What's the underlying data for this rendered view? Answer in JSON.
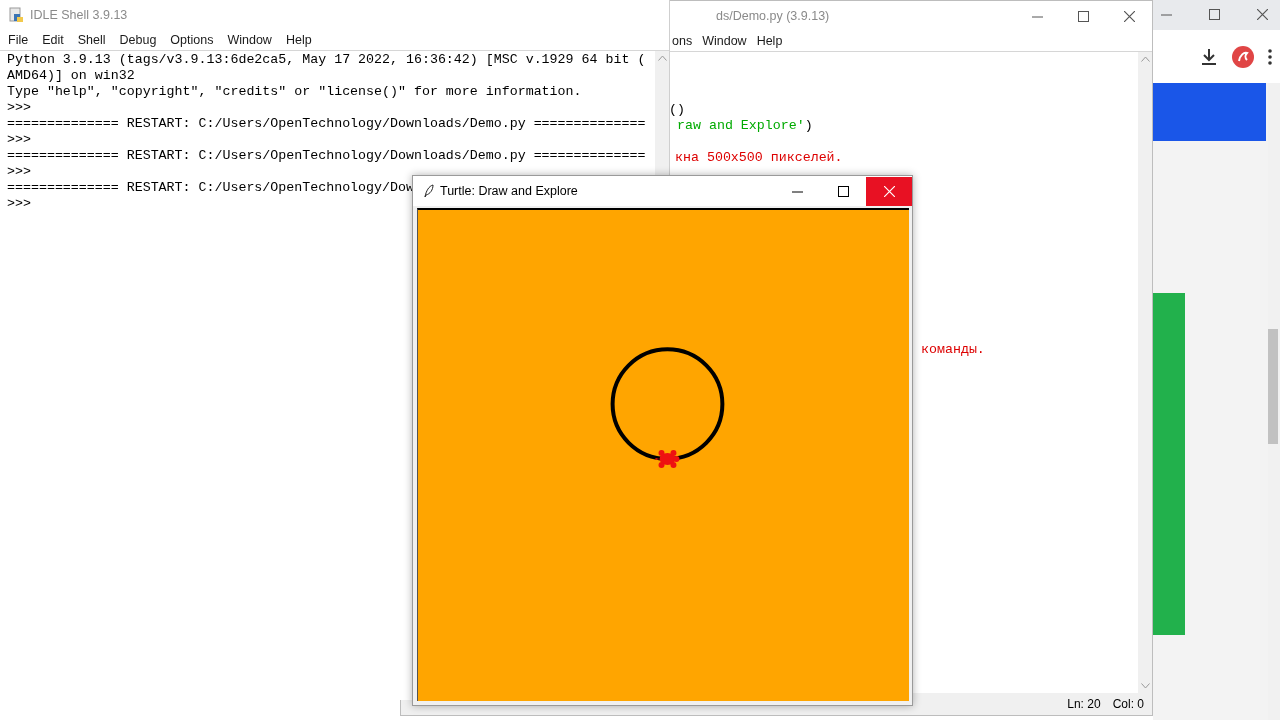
{
  "shell": {
    "title": "IDLE Shell 3.9.13",
    "menu": [
      "File",
      "Edit",
      "Shell",
      "Debug",
      "Options",
      "Window",
      "Help"
    ],
    "lines": [
      "Python 3.9.13 (tags/v3.9.13:6de2ca5, May 17 2022, 16:36:42) [MSC v.1929 64 bit (",
      "AMD64)] on win32",
      "Type \"help\", \"copyright\", \"credits\" or \"license()\" for more information.",
      ">>>",
      "============== RESTART: C:/Users/OpenTechnology/Downloads/Demo.py ==============",
      ">>>",
      "============== RESTART: C:/Users/OpenTechnology/Downloads/Demo.py ==============",
      ">>>",
      "============== RESTART: C:/Users/OpenTechnology/Dow",
      ">>>"
    ]
  },
  "editor": {
    "title": "ds/Demo.py (3.9.13)",
    "menu": [
      "ons",
      "Window",
      "Help"
    ],
    "code": [
      {
        "parts": [
          {
            "text": "()",
            "kind": "plain"
          }
        ]
      },
      {
        "parts": [
          {
            "text": "raw and Explore'",
            "kind": "string"
          },
          {
            "text": ")",
            "kind": "plain"
          }
        ]
      },
      {
        "parts": [
          {
            "text": "кна 500x500 пикселей.",
            "kind": "comment"
          }
        ]
      },
      {
        "parts": [
          {
            "text": "команды.",
            "kind": "comment"
          }
        ]
      }
    ],
    "status": {
      "line": "Ln: 20",
      "col": "Col: 0"
    }
  },
  "turtle": {
    "title": "Turtle: Draw and Explore"
  }
}
